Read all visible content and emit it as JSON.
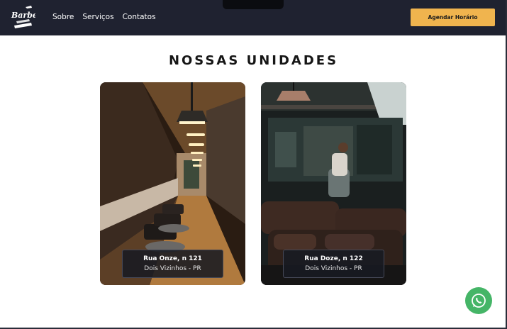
{
  "header": {
    "logo_text": "Barber",
    "nav": [
      {
        "label": "Sobre"
      },
      {
        "label": "Serviços"
      },
      {
        "label": "Contatos"
      }
    ],
    "cta_label": "Agendar Horário"
  },
  "units": {
    "title": "NOSSAS UNIDADES",
    "items": [
      {
        "street": "Rua Onze, n 121",
        "city": "Dois Vizinhos - PR"
      },
      {
        "street": "Rua Doze, n 122",
        "city": "Dois Vizinhos - PR"
      }
    ]
  },
  "floating": {
    "icon": "whatsapp-icon",
    "color": "#45b567"
  },
  "colors": {
    "nav_bg": "#1f2230",
    "accent": "#f0b44e"
  }
}
